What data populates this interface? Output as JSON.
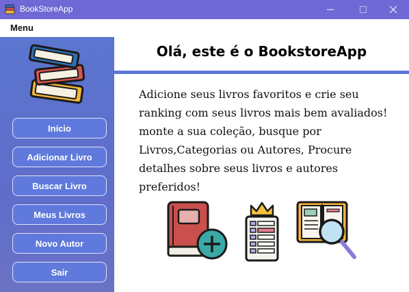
{
  "window": {
    "title": "BookStoreApp",
    "icon": "books-icon",
    "controls": [
      "minimize-icon",
      "maximize-icon",
      "close-icon"
    ]
  },
  "menubar": {
    "items": [
      "Menu"
    ]
  },
  "sidebar": {
    "logo": "books-stack-icon",
    "buttons": [
      {
        "label": "Início"
      },
      {
        "label": "Adicionar Livro"
      },
      {
        "label": "Buscar Livro"
      },
      {
        "label": "Meus Livros"
      },
      {
        "label": "Novo Autor"
      },
      {
        "label": "Sair"
      }
    ]
  },
  "main": {
    "heading": "Olá, este é o BookstoreApp",
    "description": "Adicione seus livros favoritos e crie seu ranking com seus livros mais bem avaliados! monte a sua coleção, busque por Livros,Categorias ou Autores, Procure detalhes sobre seus livros e autores preferidos!",
    "illustrations": [
      "add-book-icon",
      "ranking-list-icon",
      "book-search-icon"
    ]
  },
  "colors": {
    "titlebar": "#6f69d6",
    "sidebar": "#5f6dca",
    "button": "#5f79dc",
    "divider": "#5e77d6"
  }
}
